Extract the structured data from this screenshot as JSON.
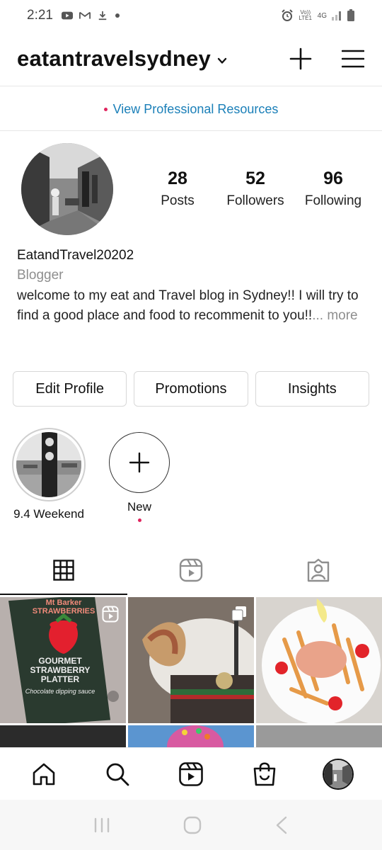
{
  "status_bar": {
    "time": "2:21",
    "left_icons": [
      "youtube-icon",
      "mail-icon",
      "download-icon",
      "dot-icon"
    ],
    "right_icons": [
      "alarm-icon",
      "volte-icon",
      "4g-icon",
      "signal-icon",
      "battery-icon"
    ],
    "network_label": "4G",
    "volte_label": "Vo)) LTE1"
  },
  "header": {
    "username": "eatantravelsydney",
    "icons": [
      "chevron-down-icon",
      "plus-icon",
      "menu-icon"
    ]
  },
  "professional": {
    "link_text": "View Professional Resources",
    "dot_color": "#e0245e",
    "link_color": "#1a7fb8"
  },
  "profile": {
    "stats": [
      {
        "value": "28",
        "label": "Posts"
      },
      {
        "value": "52",
        "label": "Followers"
      },
      {
        "value": "96",
        "label": "Following"
      }
    ],
    "display_name": "EatandTravel20202",
    "category": "Blogger",
    "bio": "welcome to my eat and Travel blog in Sydney!! I will try to find a good place and food to recommenit to you!!",
    "more": "... more"
  },
  "buttons": {
    "edit_profile": "Edit Profile",
    "promotions": "Promotions",
    "insights": "Insights"
  },
  "highlights": [
    {
      "label": "9.4 Weekend"
    },
    {
      "label": "New"
    }
  ],
  "tabs": {
    "icons": [
      "grid-icon",
      "reels-icon",
      "tagged-icon"
    ],
    "active": 0
  },
  "grid_posts": [
    {
      "text_top": "Mt Barker STRAWBERRIES",
      "text_main": "GOURMET STRAWBERRY PLATTER",
      "text_sub": "Chocolate dipping sauce",
      "badge": "reels-icon"
    },
    {
      "text_top": "",
      "text_main": "",
      "text_sub": "",
      "badge": "multi-icon"
    },
    {
      "text_top": "",
      "text_main": "",
      "text_sub": "",
      "badge": ""
    }
  ],
  "bottom_nav": {
    "icons": [
      "home-icon",
      "search-icon",
      "reels-icon",
      "shop-icon",
      "profile-avatar"
    ]
  },
  "system_nav": {
    "icons": [
      "recents-icon",
      "home-button-icon",
      "back-icon"
    ]
  }
}
